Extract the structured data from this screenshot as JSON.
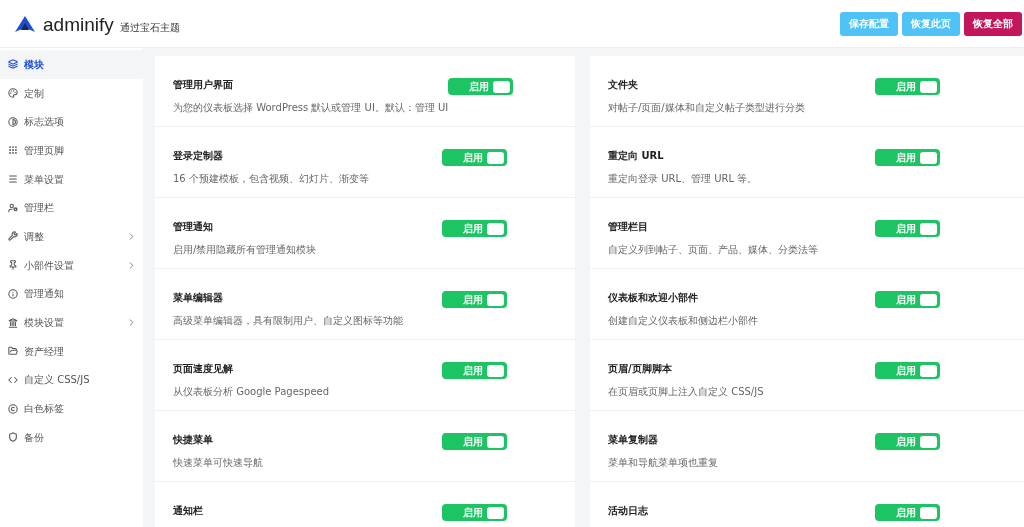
{
  "header": {
    "logo_text": "adminify",
    "tagline": "通过宝石主题",
    "buttons": [
      {
        "label": "保存配置",
        "kind": "save"
      },
      {
        "label": "恢复此页",
        "kind": "reset"
      },
      {
        "label": "恢复全部",
        "kind": "danger"
      }
    ]
  },
  "sidebar": {
    "items": [
      {
        "label": "模块",
        "selected": true,
        "has_submenu": false
      },
      {
        "label": "定制",
        "selected": false,
        "has_submenu": false
      },
      {
        "label": "标志选项",
        "selected": false,
        "has_submenu": false
      },
      {
        "label": "管理页脚",
        "selected": false,
        "has_submenu": false
      },
      {
        "label": "菜单设置",
        "selected": false,
        "has_submenu": false
      },
      {
        "label": "管理栏",
        "selected": false,
        "has_submenu": false
      },
      {
        "label": "调整",
        "selected": false,
        "has_submenu": true
      },
      {
        "label": "小部件设置",
        "selected": false,
        "has_submenu": true
      },
      {
        "label": "管理通知",
        "selected": false,
        "has_submenu": false
      },
      {
        "label": "模块设置",
        "selected": false,
        "has_submenu": true
      },
      {
        "label": "资产经理",
        "selected": false,
        "has_submenu": false
      },
      {
        "label": "自定义 CSS/JS",
        "selected": false,
        "has_submenu": false
      },
      {
        "label": "白色标签",
        "selected": false,
        "has_submenu": false
      },
      {
        "label": "备份",
        "selected": false,
        "has_submenu": false
      }
    ]
  },
  "modules": {
    "columns": [
      [
        {
          "title": "管理用户界面",
          "description": "为您的仪表板选择 WordPress 默认或管理 UI。默认：管理 UI",
          "toggle_label": "启用",
          "on": true
        },
        {
          "title": "登录定制器",
          "description": "16 个预建模板，包含视频、幻灯片、渐变等",
          "toggle_label": "启用",
          "on": true
        },
        {
          "title": "管理通知",
          "description": "启用/禁用隐藏所有管理通知模块",
          "toggle_label": "启用",
          "on": true
        },
        {
          "title": "菜单编辑器",
          "description": "高级菜单编辑器，具有限制用户、自定义图标等功能",
          "toggle_label": "启用",
          "on": true
        },
        {
          "title": "页面速度见解",
          "description": "从仪表板分析 Google Pagespeed",
          "toggle_label": "启用",
          "on": true
        },
        {
          "title": "快捷菜单",
          "description": "快速菜单可快速导航",
          "toggle_label": "启用",
          "on": true
        },
        {
          "title": "通知栏",
          "toggle_label": "启用",
          "on": true
        }
      ],
      [
        {
          "title": "文件夹",
          "description": "对帖子/页面/媒体和自定义帖子类型进行分类",
          "toggle_label": "启用",
          "on": true
        },
        {
          "title": "重定向 URL",
          "description": "重定向登录 URL、管理 URL 等。",
          "toggle_label": "启用",
          "on": true
        },
        {
          "title": "管理栏目",
          "description": "自定义列到帖子、页面、产品、媒体、分类法等",
          "toggle_label": "启用",
          "on": true
        },
        {
          "title": "仪表板和欢迎小部件",
          "description": "创建自定义仪表板和侧边栏小部件",
          "toggle_label": "启用",
          "on": true
        },
        {
          "title": "页眉/页脚脚本",
          "description": "在页眉或页脚上注入自定义 CSS/JS",
          "toggle_label": "启用",
          "on": true
        },
        {
          "title": "菜单复制器",
          "description": "菜单和导航菜单项也重复",
          "toggle_label": "启用",
          "on": true
        },
        {
          "title": "活动日志",
          "toggle_label": "启用",
          "on": true
        }
      ]
    ]
  }
}
